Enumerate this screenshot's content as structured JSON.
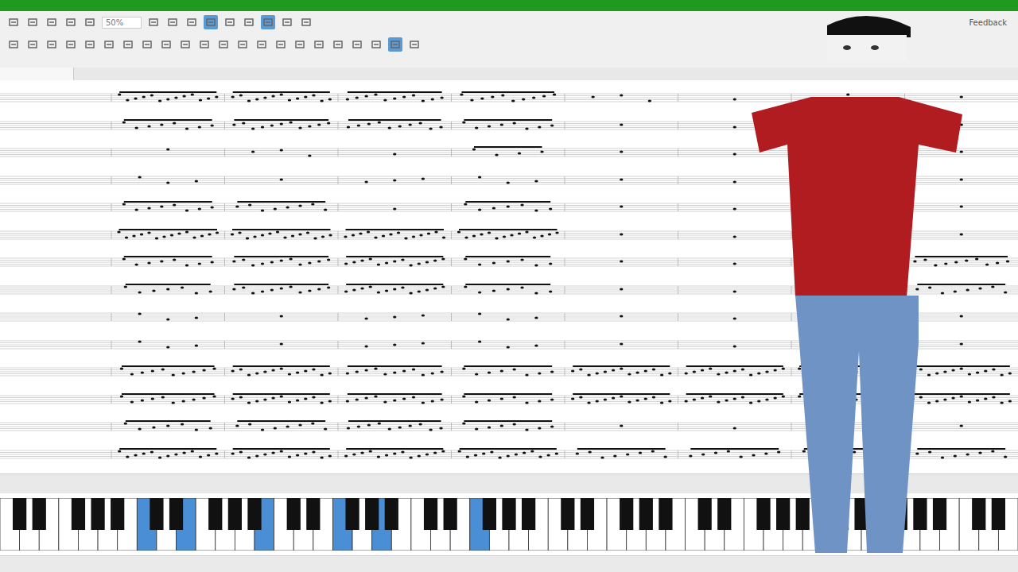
{
  "toolbar": {
    "zoom": "50%",
    "feedback": "Feedback",
    "tools": [
      {
        "selected": false
      },
      {
        "selected": false
      },
      {
        "selected": false
      },
      {
        "selected": false
      },
      {
        "selected": false
      },
      {
        "selected": false
      },
      {
        "selected": false
      },
      {
        "selected": false
      },
      {
        "selected": true
      },
      {
        "selected": false
      },
      {
        "selected": false
      },
      {
        "selected": true
      },
      {
        "selected": false
      },
      {
        "selected": false
      }
    ],
    "tools2": [
      {
        "selected": false
      },
      {
        "selected": false
      },
      {
        "selected": false
      },
      {
        "selected": false
      },
      {
        "selected": false
      },
      {
        "selected": false
      },
      {
        "selected": false
      },
      {
        "selected": false
      },
      {
        "selected": false
      },
      {
        "selected": false
      },
      {
        "selected": false
      },
      {
        "selected": false
      },
      {
        "selected": false
      },
      {
        "selected": false
      },
      {
        "selected": false
      },
      {
        "selected": false
      },
      {
        "selected": false
      },
      {
        "selected": false
      },
      {
        "selected": false
      },
      {
        "selected": false
      },
      {
        "selected": true
      },
      {
        "selected": false
      }
    ]
  },
  "score": {
    "staves": [
      {
        "measures": [
          0.9,
          0.9,
          0.8,
          0.7,
          0.2,
          0.1,
          0.1,
          0.1
        ]
      },
      {
        "measures": [
          0.6,
          0.8,
          0.7,
          0.6,
          0.1,
          0.1,
          0.1,
          0.1
        ]
      },
      {
        "measures": [
          0.1,
          0.2,
          0.1,
          0.3,
          0.1,
          0.1,
          0.1,
          0.1
        ]
      },
      {
        "measures": [
          0.2,
          0.1,
          0.2,
          0.2,
          0.1,
          0.1,
          0.1,
          0.1
        ]
      },
      {
        "measures": [
          0.6,
          0.6,
          0.1,
          0.5,
          0.1,
          0.1,
          0.1,
          0.1
        ]
      },
      {
        "measures": [
          1.0,
          1.0,
          1.0,
          1.0,
          0.1,
          0.1,
          0.1,
          0.1
        ]
      },
      {
        "measures": [
          0.6,
          0.8,
          0.9,
          0.5,
          0.1,
          0.1,
          0.1,
          0.7
        ]
      },
      {
        "measures": [
          0.5,
          0.8,
          0.9,
          0.5,
          0.1,
          0.1,
          0.1,
          0.6
        ]
      },
      {
        "measures": [
          0.2,
          0.1,
          0.2,
          0.2,
          0.1,
          0.1,
          0.1,
          0.1
        ]
      },
      {
        "measures": [
          0.2,
          0.1,
          0.2,
          0.2,
          0.1,
          0.1,
          0.1,
          0.1
        ]
      },
      {
        "measures": [
          0.7,
          0.9,
          0.8,
          0.6,
          0.9,
          0.9,
          0.9,
          0.9
        ]
      },
      {
        "measures": [
          0.7,
          0.9,
          0.8,
          0.6,
          0.9,
          0.9,
          0.9,
          0.9
        ]
      },
      {
        "measures": [
          0.5,
          0.6,
          0.7,
          0.6,
          0.1,
          0.1,
          0.1,
          0.1
        ]
      },
      {
        "measures": [
          0.9,
          0.9,
          0.9,
          0.9,
          0.6,
          0.6,
          0.6,
          0.6
        ]
      }
    ]
  },
  "keyboard": {
    "white_keys": [
      {
        "pressed": false
      },
      {
        "pressed": false
      },
      {
        "pressed": false
      },
      {
        "pressed": false
      },
      {
        "pressed": false
      },
      {
        "pressed": false
      },
      {
        "pressed": false
      },
      {
        "pressed": true
      },
      {
        "pressed": false
      },
      {
        "pressed": true
      },
      {
        "pressed": false
      },
      {
        "pressed": false
      },
      {
        "pressed": false
      },
      {
        "pressed": true
      },
      {
        "pressed": false
      },
      {
        "pressed": false
      },
      {
        "pressed": false
      },
      {
        "pressed": true
      },
      {
        "pressed": false
      },
      {
        "pressed": true
      },
      {
        "pressed": false
      },
      {
        "pressed": false
      },
      {
        "pressed": false
      },
      {
        "pressed": false
      },
      {
        "pressed": true
      },
      {
        "pressed": false
      },
      {
        "pressed": false
      },
      {
        "pressed": false
      },
      {
        "pressed": false
      },
      {
        "pressed": false
      },
      {
        "pressed": false
      },
      {
        "pressed": false
      },
      {
        "pressed": false
      },
      {
        "pressed": false
      },
      {
        "pressed": false
      },
      {
        "pressed": false
      },
      {
        "pressed": false
      },
      {
        "pressed": false
      },
      {
        "pressed": false
      },
      {
        "pressed": false
      },
      {
        "pressed": false
      },
      {
        "pressed": false
      },
      {
        "pressed": false
      },
      {
        "pressed": false
      },
      {
        "pressed": false
      },
      {
        "pressed": false
      },
      {
        "pressed": false
      },
      {
        "pressed": false
      },
      {
        "pressed": false
      },
      {
        "pressed": false
      },
      {
        "pressed": false
      },
      {
        "pressed": false
      }
    ]
  }
}
